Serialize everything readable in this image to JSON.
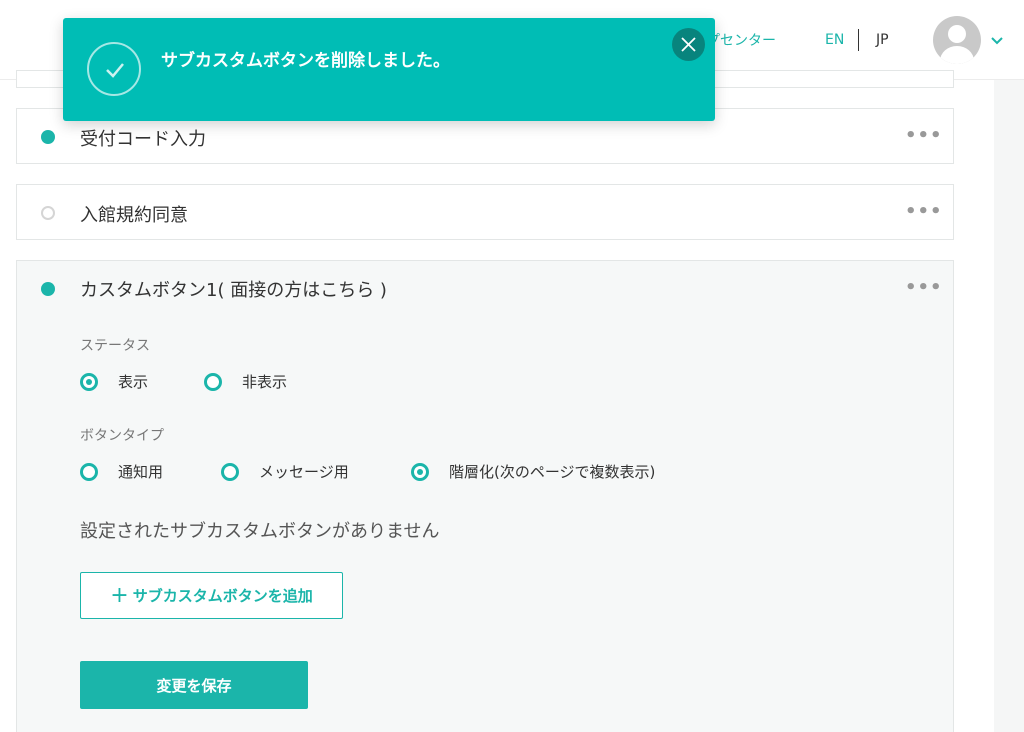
{
  "header": {
    "help_link": "プセンター",
    "lang_en": "EN",
    "lang_jp": "JP"
  },
  "toast": {
    "message": "サブカスタムボタンを削除しました。",
    "icon": "check-icon"
  },
  "cards": [
    {
      "title": "受付コード入力",
      "active": true
    },
    {
      "title": "入館規約同意",
      "active": false
    },
    {
      "title": "カスタムボタン1( 面接の方はこちら )",
      "active": true
    }
  ],
  "expanded": {
    "status_label": "ステータス",
    "status_options": [
      "表示",
      "非表示"
    ],
    "status_selected": "表示",
    "type_label": "ボタンタイプ",
    "type_options": [
      "通知用",
      "メッセージ用",
      "階層化(次のページで複数表示)"
    ],
    "type_selected": "階層化(次のページで複数表示)",
    "empty_message": "設定されたサブカスタムボタンがありません",
    "add_button": "サブカスタムボタンを追加",
    "save_button": "変更を保存"
  },
  "more_glyph": "•••",
  "colors": {
    "accent": "#1bb5aa",
    "toast": "#00bdb5",
    "toast_close": "#08847d"
  }
}
